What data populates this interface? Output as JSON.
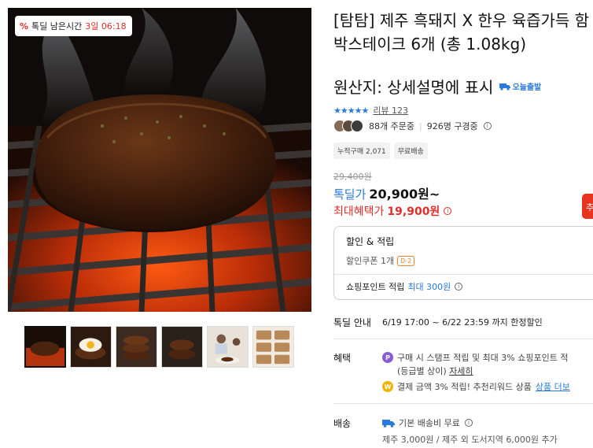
{
  "gallery": {
    "deal_badge": {
      "icon": "percent-icon",
      "label": "톡딜 남은시간",
      "time": "3일 06:18"
    },
    "thumbnails": [
      {
        "name": "thumb-grill-patty",
        "active": true
      },
      {
        "name": "thumb-patty-egg",
        "active": false
      },
      {
        "name": "thumb-stack-3",
        "active": false
      },
      {
        "name": "thumb-stack-2",
        "active": false
      },
      {
        "name": "thumb-people-dining",
        "active": false
      },
      {
        "name": "thumb-packages",
        "active": false
      }
    ]
  },
  "product": {
    "title": "[탐탐] 제주 흑돼지 X 한우 육즙가득 함박스테이크 6개 (총 1.08kg)",
    "origin": "원산지: 상세설명에 표시",
    "shipping_badge": "오늘출발",
    "rating_stars": "★★★★★",
    "review_label": "리뷰 123",
    "orders_label": "88개 주문중",
    "viewers_label": "926명 구경중",
    "chips": [
      "누적구매 2,071",
      "무료배송"
    ]
  },
  "price": {
    "original": "29,400원",
    "deal_label": "톡딜가",
    "deal_price": "20,900원~",
    "max_label": "최대혜택가",
    "max_price": "19,900원",
    "cta_peek": "추"
  },
  "benefit_box": {
    "heading": "할인 & 적립",
    "coupon": "할인쿠폰 1개",
    "dday": "D-2",
    "points_label": "쇼핑포인트 적립",
    "points_value": "최대 300원"
  },
  "deal_info": {
    "label": "톡딜 안내",
    "period": "6/19 17:00 ~ 6/22 23:59 까지 한정할인"
  },
  "benefits": {
    "label": "혜택",
    "line1": "구매 시 스탬프 적립 및 최대 3% 쇼핑포인트 적",
    "line1b": "(등급별 상이)",
    "line1_link": "자세히",
    "line2": "결제 금액 3% 적립! 추천리워드 상품",
    "line2_link": "상품 더보",
    "coin1": "P",
    "coin2": "W"
  },
  "shipping": {
    "label": "배송",
    "line1": "기본 배송비 무료",
    "line2": "제주 3,000원 / 제주 외 도서지역 6,000원 추가"
  },
  "colors": {
    "accent_blue": "#2b7bdc",
    "sale_red": "#e0302a",
    "cta_red": "#e8331f"
  }
}
